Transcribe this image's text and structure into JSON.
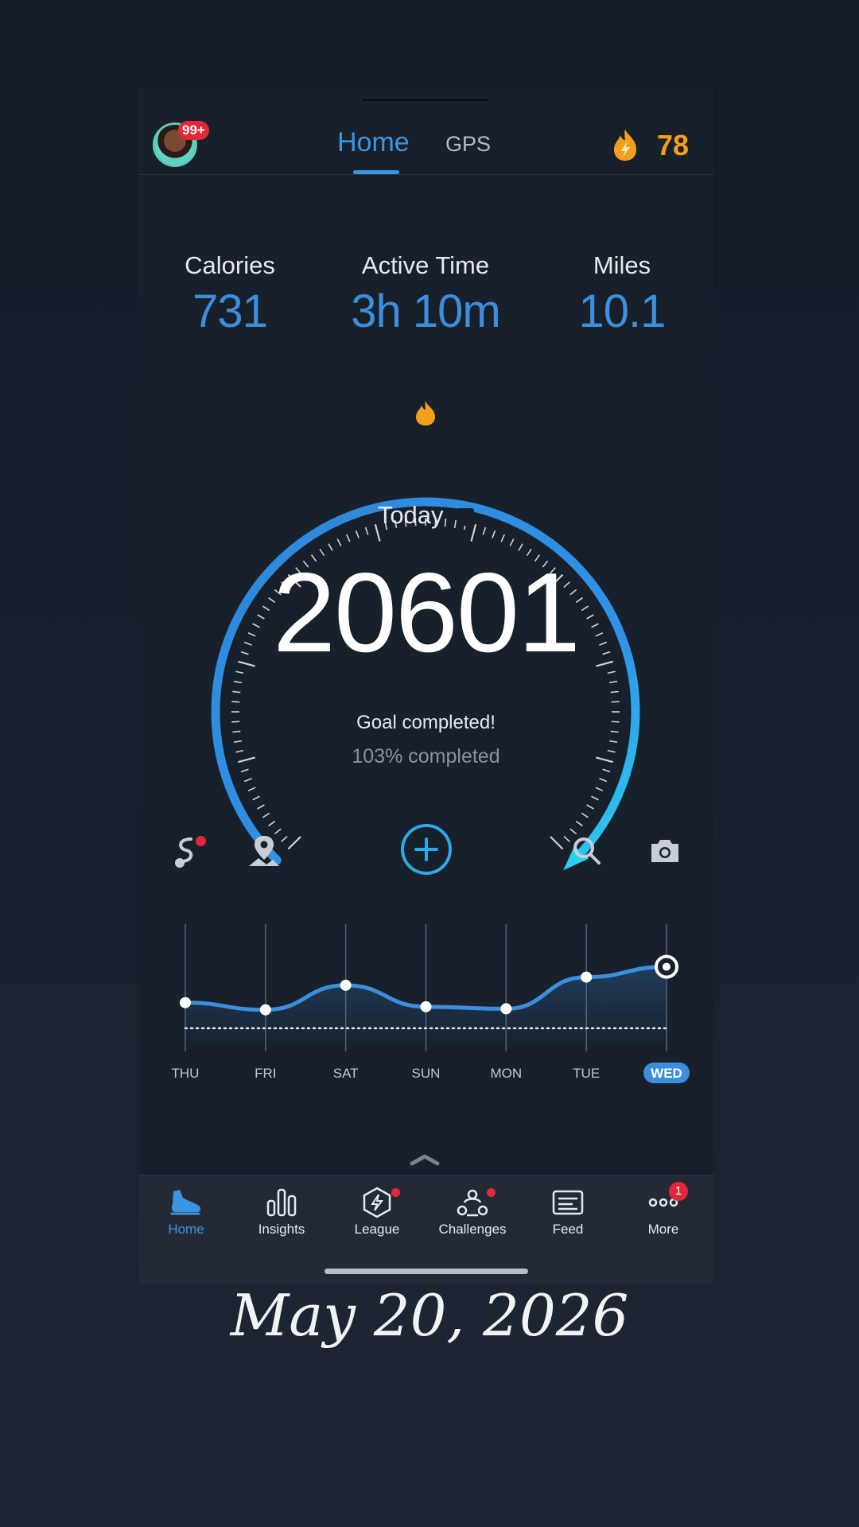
{
  "header": {
    "notification_badge": "99+",
    "tabs": [
      {
        "label": "Home"
      },
      {
        "label": "GPS"
      }
    ],
    "active_tab": "Home",
    "streak_count": "78"
  },
  "stats": [
    {
      "label": "Calories",
      "value": "731"
    },
    {
      "label": "Active Time",
      "value": "3h 10m"
    },
    {
      "label": "Miles",
      "value": "10.1"
    }
  ],
  "gauge": {
    "period_label": "Today",
    "steps": "20601",
    "goal_text": "Goal completed!",
    "percent_text": "103% completed"
  },
  "actions": [
    "route-icon",
    "map-pin-icon",
    "add-icon",
    "search-icon",
    "camera-icon"
  ],
  "week": {
    "days": [
      "THU",
      "FRI",
      "SAT",
      "SUN",
      "MON",
      "TUE",
      "WED"
    ],
    "selected_day": "WED",
    "steps": [
      20250,
      20180,
      20420,
      20210,
      20190,
      20500,
      20601
    ],
    "goal_line": 20000
  },
  "bottom_nav": [
    {
      "label": "Home",
      "icon": "shoe-icon",
      "active": true
    },
    {
      "label": "Insights",
      "icon": "bar-chart-icon"
    },
    {
      "label": "League",
      "icon": "hexagon-bolt-icon"
    },
    {
      "label": "Challenges",
      "icon": "group-icon"
    },
    {
      "label": "Feed",
      "icon": "feed-icon"
    },
    {
      "label": "More",
      "icon": "more-icon",
      "badge": "1"
    }
  ],
  "caption": "May 20, 2026",
  "colors": {
    "accent": "#3c8fdd",
    "streak": "#f2a01c",
    "badge": "#e0283a",
    "background": "#18202c"
  }
}
